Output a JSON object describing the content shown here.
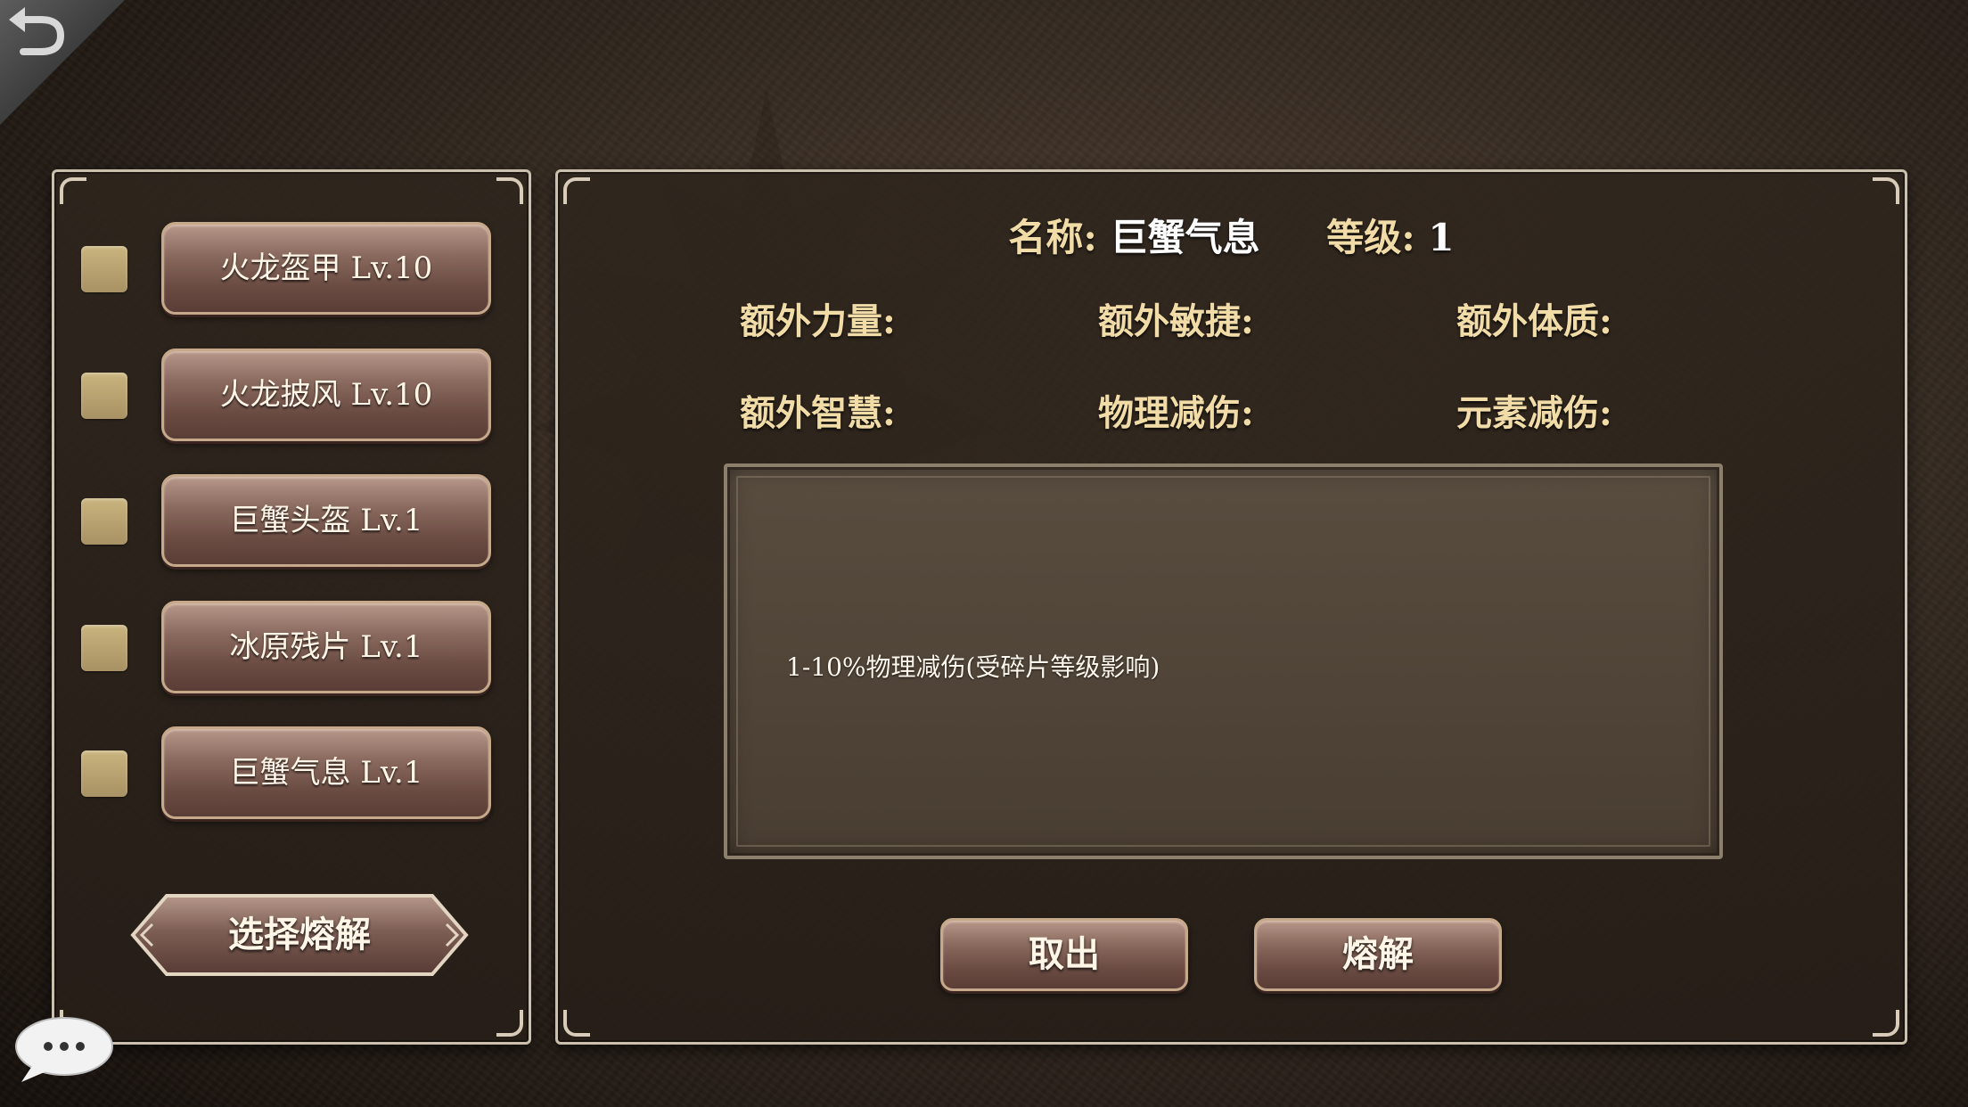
{
  "back_icon": "return-arrow-icon",
  "items": [
    {
      "label": "火龙盔甲 Lv.10",
      "checked": false
    },
    {
      "label": "火龙披风 Lv.10",
      "checked": false
    },
    {
      "label": "巨蟹头盔 Lv.1",
      "checked": false
    },
    {
      "label": "冰原残片 Lv.1",
      "checked": false
    },
    {
      "label": "巨蟹气息 Lv.1",
      "checked": false
    }
  ],
  "select_smelt_label": "选择熔解",
  "detail": {
    "name_label": "名称:",
    "name_value": "巨蟹气息",
    "level_label": "等级:",
    "level_value": "1",
    "stats": {
      "extra_strength": "额外力量:",
      "extra_agility": "额外敏捷:",
      "extra_constitution": "额外体质:",
      "extra_wisdom": "额外智慧:",
      "physical_reduction": "物理减伤:",
      "elemental_reduction": "元素减伤:"
    },
    "description": "1-10%物理减伤(受碎片等级影响)"
  },
  "buttons": {
    "take_out": "取出",
    "smelt": "熔解"
  },
  "chat_icon": "chat-bubble-icon",
  "colors": {
    "checkbox": "#b9a36f",
    "button": "#7a5c52",
    "label": "#f1dca8"
  }
}
